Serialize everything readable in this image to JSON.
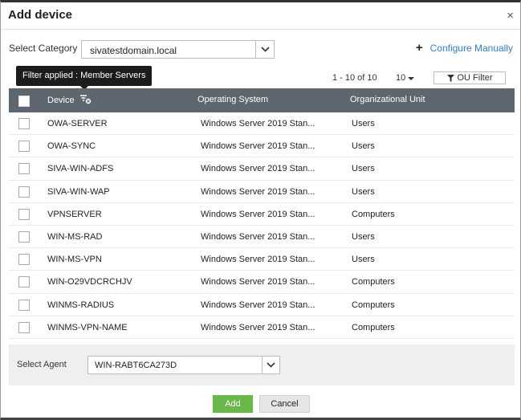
{
  "dialog": {
    "title": "Add device",
    "close_glyph": "×"
  },
  "category": {
    "label": "Select Category",
    "value": "sivatestdomain.local"
  },
  "configure": {
    "label": "Configure Manually"
  },
  "tooltip": {
    "text": "Filter applied : Member Servers"
  },
  "pagination": {
    "range": "1 - 10 of 10",
    "per_page": "10"
  },
  "ou_filter": {
    "label": "OU Filter"
  },
  "table": {
    "headers": {
      "device": "Device",
      "os": "Operating System",
      "ou": "Organizational Unit"
    },
    "rows": [
      {
        "device": "OWA-SERVER",
        "os": "Windows Server 2019 Stan...",
        "ou": "Users"
      },
      {
        "device": "OWA-SYNC",
        "os": "Windows Server 2019 Stan...",
        "ou": "Users"
      },
      {
        "device": "SIVA-WIN-ADFS",
        "os": "Windows Server 2019 Stan...",
        "ou": "Users"
      },
      {
        "device": "SIVA-WIN-WAP",
        "os": "Windows Server 2019 Stan...",
        "ou": "Users"
      },
      {
        "device": "VPNSERVER",
        "os": "Windows Server 2019 Stan...",
        "ou": "Computers"
      },
      {
        "device": "WIN-MS-RAD",
        "os": "Windows Server 2019 Stan...",
        "ou": "Users"
      },
      {
        "device": "WIN-MS-VPN",
        "os": "Windows Server 2019 Stan...",
        "ou": "Users"
      },
      {
        "device": "WIN-O29VDCRCHJV",
        "os": "Windows Server 2019 Stan...",
        "ou": "Computers"
      },
      {
        "device": "WINMS-RADIUS",
        "os": "Windows Server 2019 Stan...",
        "ou": "Computers"
      },
      {
        "device": "WINMS-VPN-NAME",
        "os": "Windows Server 2019 Stan...",
        "ou": "Computers"
      }
    ]
  },
  "agent": {
    "label": "Select Agent",
    "value": "WIN-RABT6CA273D"
  },
  "buttons": {
    "add": "Add",
    "cancel": "Cancel"
  },
  "colors": {
    "header_bg": "#5e6670",
    "add_button": "#68b84a",
    "link": "#2a7fd4"
  },
  "icons": [
    "close-icon",
    "chevron-down-icon",
    "plus-icon",
    "filter-icon",
    "funnel-icon"
  ]
}
